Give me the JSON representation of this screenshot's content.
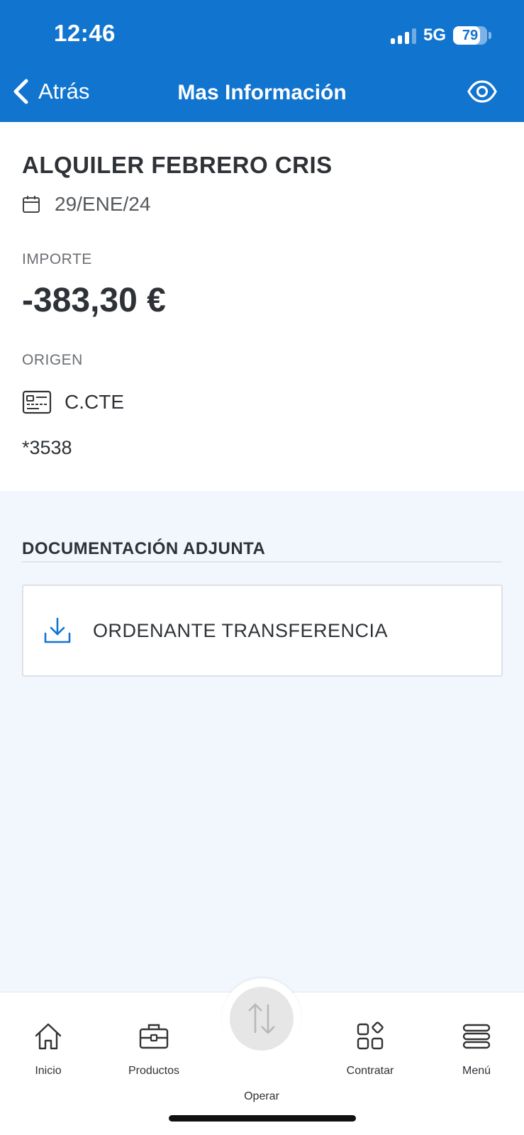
{
  "status_bar": {
    "time": "12:46",
    "network": "5G",
    "battery": "79",
    "battery_level": 0.79
  },
  "nav": {
    "back_label": "Atrás",
    "title": "Mas Información",
    "right_icon": "eye-icon"
  },
  "movement": {
    "concept": "ALQUILER FEBRERO CRIS",
    "date": "29/ENE/24",
    "amount_label": "IMPORTE",
    "amount": "-383,30 €",
    "origin_label": "ORIGEN",
    "origin_name": "C.CTE",
    "account": "*3538"
  },
  "documents": {
    "title": "DOCUMENTACIÓN ADJUNTA",
    "items": [
      {
        "label": "ORDENANTE TRANSFERENCIA",
        "icon": "download-icon"
      }
    ]
  },
  "tabbar": {
    "items": [
      {
        "label": "Inicio",
        "icon": "home-icon"
      },
      {
        "label": "Productos",
        "icon": "briefcase-icon"
      },
      {
        "label": "Operar",
        "icon": "transfer-arrows-icon"
      },
      {
        "label": "Contratar",
        "icon": "apps-icon"
      },
      {
        "label": "Menú",
        "icon": "menu-icon"
      }
    ]
  },
  "colors": {
    "primary": "#1174cf",
    "background": "#f2f6fd",
    "text": "#2e3237"
  }
}
